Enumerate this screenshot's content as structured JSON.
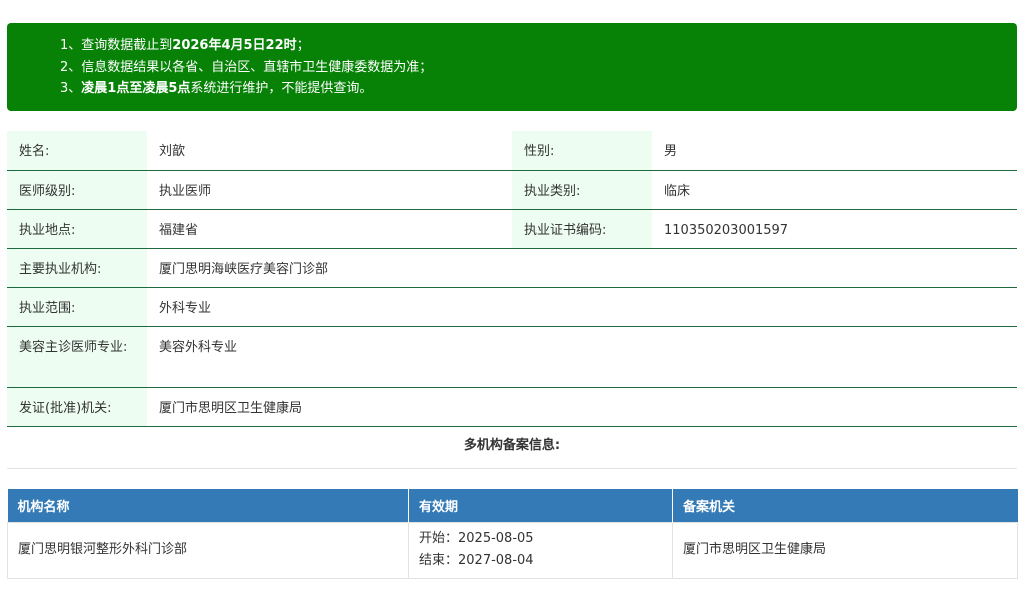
{
  "notice": {
    "line1_prefix": "1、查询数据截止到",
    "line1_bold": "2026年4月5日22时",
    "line1_suffix": "；",
    "line2": "2、信息数据结果以各省、自治区、直辖市卫生健康委数据为准；",
    "line3_prefix": "3、",
    "line3_bold": "凌晨1点至凌晨5点",
    "line3_suffix": "系统进行维护，不能提供查询。"
  },
  "doctor": {
    "name_label": "姓名:",
    "name": "刘歆",
    "gender_label": "性别:",
    "gender": "男",
    "level_label": "医师级别:",
    "level": "执业医师",
    "category_label": "执业类别:",
    "category": "临床",
    "location_label": "执业地点:",
    "location": "福建省",
    "cert_label": "执业证书编码:",
    "cert": "110350203001597",
    "org_label": "主要执业机构:",
    "org": "厦门思明海峡医疗美容门诊部",
    "scope_label": "执业范围:",
    "scope": "外科专业",
    "cosmetic_label": "美容主诊医师专业:",
    "cosmetic": "美容外科专业",
    "issuer_label": "发证(批准)机关:",
    "issuer": "厦门市思明区卫生健康局"
  },
  "records": {
    "title": "多机构备案信息:",
    "headers": [
      "机构名称",
      "有效期",
      "备案机关"
    ],
    "rows": [
      {
        "org": "厦门思明银河整形外科门诊部",
        "start": "开始：2025-08-05",
        "end": "结束：2027-08-04",
        "authority": "厦门市思明区卫生健康局"
      }
    ]
  },
  "colors": {
    "notice_bg": "#078207",
    "label_bg": "#edfdf2",
    "row_border": "#1f6b3f",
    "header_bg": "#337ab7"
  }
}
